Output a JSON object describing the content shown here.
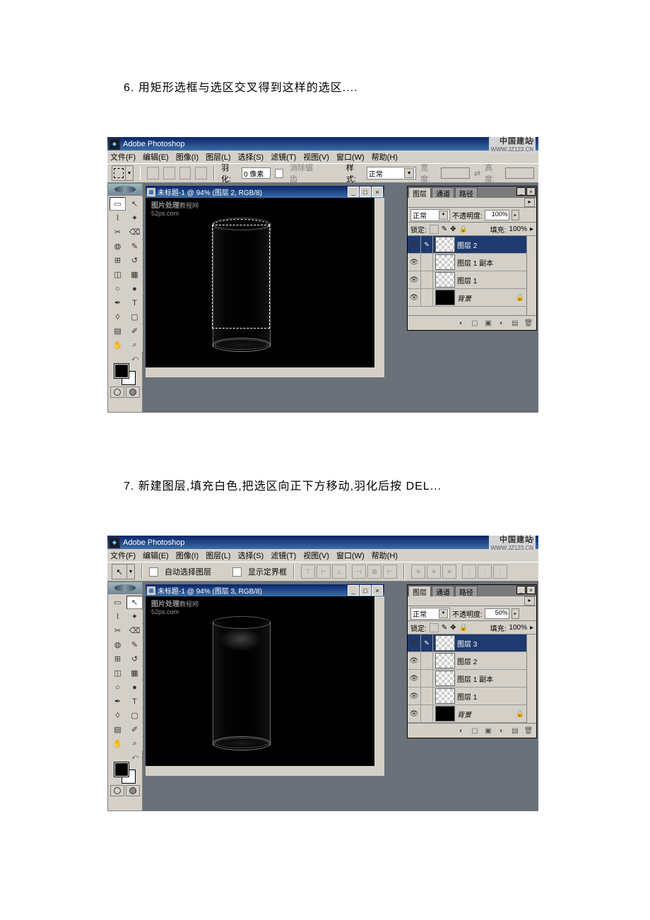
{
  "step6": {
    "caption": "6. 用矩形选框与选区交叉得到这样的选区....",
    "app_title": "Adobe Photoshop",
    "brand_cn": "中国建站",
    "brand_url": "WWW.JZ123.CN",
    "menus": [
      "文件(F)",
      "编辑(E)",
      "图像(I)",
      "图层(L)",
      "选择(S)",
      "滤镜(T)",
      "视图(V)",
      "窗口(W)",
      "帮助(H)"
    ],
    "feather_label": "羽化:",
    "feather_value": "0 像素",
    "antialias": "消除锯齿",
    "style_label": "样式:",
    "style_value": "正常",
    "width_label": "宽度:",
    "height_label": "高度:",
    "doc_title": "未标题-1 @ 94% (图层 2, RGB/8)",
    "watermark_1": "图片处理",
    "watermark_2": "52ps.com",
    "watermark_3": "教程网",
    "tabs": {
      "layers": "图层",
      "channels": "通道",
      "paths": "路径"
    },
    "blend_mode": "正常",
    "opacity_label": "不透明度:",
    "opacity_value": "100%",
    "lock_label": "锁定:",
    "fill_label": "填充:",
    "fill_value": "100%",
    "layers": [
      {
        "name": "图层 2",
        "sel": true,
        "thumb": "trans"
      },
      {
        "name": "图层 1 副本",
        "sel": false,
        "thumb": "trans"
      },
      {
        "name": "图层 1",
        "sel": false,
        "thumb": "trans"
      },
      {
        "name": "背景",
        "sel": false,
        "thumb": "black",
        "locked": true
      }
    ]
  },
  "step7": {
    "caption": "7. 新建图层,填充白色,把选区向正下方移动,羽化后按 DEL...",
    "app_title": "Adobe Photoshop",
    "brand_cn": "中国建站",
    "brand_url": "WWW.JZ123.CN",
    "menus": [
      "文件(F)",
      "编辑(E)",
      "图像(I)",
      "图层(L)",
      "选择(S)",
      "滤镜(T)",
      "视图(V)",
      "窗口(W)",
      "帮助(H)"
    ],
    "auto_select": "自动选择图层",
    "show_bounds": "显示定界框",
    "doc_title": "未标题-1 @ 94% (图层 3, RGB/8)",
    "watermark_1": "图片处理",
    "watermark_2": "52ps.com",
    "watermark_3": "教程网",
    "tabs": {
      "layers": "图层",
      "channels": "通道",
      "paths": "路径"
    },
    "blend_mode": "正常",
    "opacity_label": "不透明度:",
    "opacity_value": "50%",
    "lock_label": "锁定:",
    "fill_label": "填充:",
    "fill_value": "100%",
    "layers": [
      {
        "name": "图层 3",
        "sel": true,
        "thumb": "trans"
      },
      {
        "name": "图层 2",
        "sel": false,
        "thumb": "trans"
      },
      {
        "name": "图层 1 副本",
        "sel": false,
        "thumb": "trans"
      },
      {
        "name": "图层 1",
        "sel": false,
        "thumb": "trans"
      },
      {
        "name": "背景",
        "sel": false,
        "thumb": "black",
        "locked": true
      }
    ]
  }
}
